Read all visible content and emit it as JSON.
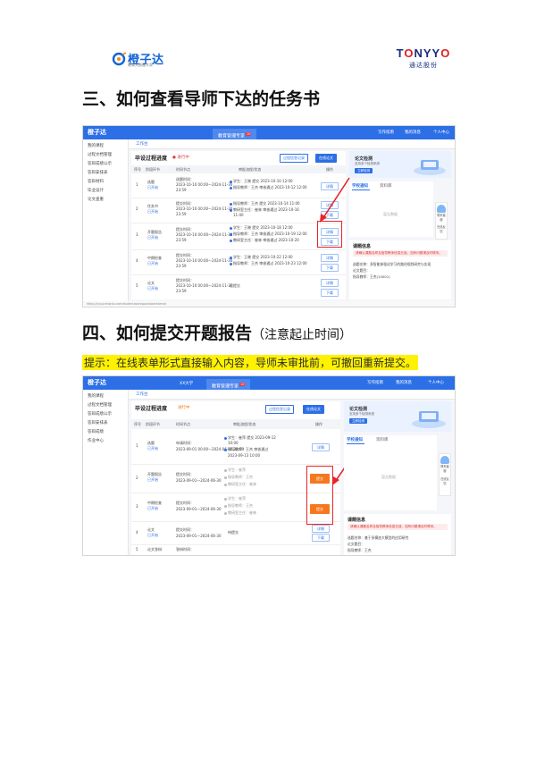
{
  "header": {
    "left_logo_name": "橙子达",
    "left_logo_sub": "教育大数据专家",
    "right_logo_brand_a": "T",
    "right_logo_brand_o": "O",
    "right_logo_brand_b": "NYY",
    "right_logo_brand_o2": "O",
    "right_logo_cn": "通达股份"
  },
  "section3": {
    "title": "三、如何查看导师下达的任务书"
  },
  "section4": {
    "title": "四、如何提交开题报告",
    "note": "（注意起止时间）",
    "hint": "提示：在线表单形式直接输入内容，导师未审批前，可撤回重新提交。"
  },
  "shot1": {
    "logo": "橙子达",
    "tab": "教育管理专家",
    "tab_badge": "10",
    "top_right": [
      "写作指南",
      "我的消息",
      "个人中心"
    ],
    "sidebar": [
      "我的课程",
      "过程文档管理",
      "答辩成绩公示",
      "答辩安排表",
      "答辩材料",
      "毕业设计",
      "论文查重"
    ],
    "subtab": "工作台",
    "panel_title": "毕设过程进度",
    "panel_status": "● 进行中",
    "btn_outline": "过程信息记录",
    "btn_fill": "在线论文",
    "thead": [
      "序号",
      "阶段环节",
      "时间节点",
      "审批流程/状态",
      "操作"
    ],
    "rows": [
      {
        "no": "1",
        "stage": "选题",
        "stage_sub": "已开始",
        "time1": "选题时间：",
        "time2": "2023-10-10 00:00—2024-11-30",
        "time3": "23:59",
        "flow1": "学生：王晓  提交  2023-10-10 12:00",
        "flow2": "指导教师：王杰  审核通过  2023-10-12 12:00",
        "flow3": "",
        "ops": [
          "详情"
        ]
      },
      {
        "no": "2",
        "stage": "任务书",
        "stage_sub": "已开始",
        "time1": "提交时间：",
        "time2": "2023-10-10 00:00—2024-11-30",
        "time3": "23:59",
        "flow1": "指导教师：王杰  提交  2023-10-14 11:00",
        "flow2": "教研室主任：崔林  审核通过  2023-10-16",
        "flow3": "11:00",
        "ops": [
          "详情",
          "下载"
        ]
      },
      {
        "no": "3",
        "stage": "开题报告",
        "stage_sub": "已开始",
        "time1": "提交时间：",
        "time2": "2023-10-10 00:00—2024-11-30",
        "time3": "23:59",
        "flow1": "学生：王晓  提交  2023-10-18 12:00",
        "flow2": "指导教师：王杰  审核通过  2023-10-19 12:00",
        "flow3": "教研室主任：崔林  审核通过  2023-10-20",
        "ops": [
          "详情",
          "下载"
        ]
      },
      {
        "no": "4",
        "stage": "中期检查",
        "stage_sub": "已开始",
        "time1": "提交时间：",
        "time2": "2023-10-10 00:00—2024-11-30",
        "time3": "23:59",
        "flow1": "学生：王晓  提交  2023-10-22 12:00",
        "flow2": "指导教师：王杰  审核通过  2023-10-23 12:00",
        "flow3": "",
        "ops": [
          "详情",
          "下载"
        ]
      },
      {
        "no": "5",
        "stage": "论文",
        "stage_sub": "已开始",
        "time1": "提交时间：",
        "time2": "2023-10-10 00:00—2024-11-30",
        "time3": "23:59",
        "flow1": "已提交",
        "flow2": "",
        "flow3": "",
        "ops": [
          "详情",
          "下载"
        ]
      }
    ],
    "rp_card_title": "论文检测",
    "rp_card_sub": "支持多个检测系统",
    "rp_card_btn": "立即检测",
    "rp_tabs": [
      "学校通知",
      "资料库"
    ],
    "rp_empty": "暂无数据",
    "float_items": [
      "联系客服",
      "在线反馈"
    ],
    "topic_title": "课题信息",
    "topic_warn": "请确认课题名称及指导教师信息无误，如有问题请及时联系。",
    "topic_lines": [
      "选题名称：多智能体强化学习的路径规划研究与实现",
      "论文题目：",
      "指导教师：王杰(10001)"
    ],
    "status_url": "https://cxy.orchardx.com/student/workspace/workbench"
  },
  "shot2": {
    "logo": "橙子达",
    "school": "XX大学",
    "tab": "教育管理专家",
    "tab_badge": "10",
    "top_right": [
      "写作指南",
      "我的消息",
      "个人中心"
    ],
    "sidebar": [
      "我的课程",
      "过程文档管理",
      "答辩成绩公示",
      "答辩安排表",
      "答辩成绩",
      "作业中心"
    ],
    "subtab": "工作台",
    "panel_title": "毕设过程进度",
    "panel_status": "进行中",
    "btn_outline": "过程信息记录",
    "btn_fill": "在线论文",
    "thead": [
      "序号",
      "阶段环节",
      "时间节点",
      "审批流程/状态",
      "操作"
    ],
    "rows": [
      {
        "no": "1",
        "stage": "选题",
        "stage_sub": "已开始",
        "time1": "申请时间：",
        "time2": "2023-09-01 00:00—2024-06-30 23:59",
        "flow1": "学生：崔萍  提交  2023-09-12",
        "flow2": "10:00",
        "flow3": "指导教师：王杰  审核通过",
        "flow4": "2023-09-13 10:00",
        "ops": [
          "详情"
        ]
      },
      {
        "no": "2",
        "stage": "开题报告",
        "stage_sub": "已开始",
        "time1": "提交时间：",
        "time2": "2023-09-01—2024-06-30",
        "flow1": "学生：崔萍",
        "flow2": "指导教师：王杰",
        "flow3": "教研室主任：崔林",
        "flow4": "",
        "ops": [
          "提交"
        ]
      },
      {
        "no": "3",
        "stage": "中期检查",
        "stage_sub": "已开始",
        "time1": "提交时间：",
        "time2": "2023-09-01—2024-06-30",
        "flow1": "学生：崔萍",
        "flow2": "指导教师：王杰",
        "flow3": "教研室主任：崔林",
        "flow4": "",
        "ops": [
          "提交"
        ]
      },
      {
        "no": "4",
        "stage": "论文",
        "stage_sub": "已开始",
        "time1": "提交时间：",
        "time2": "2023-09-01—2024-06-30",
        "flow1": "待提交",
        "flow2": "",
        "flow3": "",
        "flow4": "",
        "ops": [
          "详情",
          "下载"
        ]
      },
      {
        "no": "5",
        "stage": "论文答辩",
        "stage_sub": "",
        "time1": "答辩时间：",
        "time2": "",
        "flow1": "",
        "flow2": "",
        "flow3": "",
        "flow4": "",
        "ops": []
      }
    ],
    "rp_card_title": "论文检测",
    "rp_card_sub": "支持多个检测系统",
    "rp_card_btn": "立即检测",
    "rp_tabs": [
      "学校通知",
      "资料库"
    ],
    "rp_empty": "暂无数据",
    "float_items": [
      "联系客服",
      "在线反馈"
    ],
    "topic_title": "课题信息",
    "topic_warn": "请确认课题名称及指导教师信息无误，如有问题请及时联系。",
    "topic_lines": [
      "选题名称：基于多模态大模型的应用研究",
      "论文题目：",
      "指导教师：王杰"
    ]
  }
}
